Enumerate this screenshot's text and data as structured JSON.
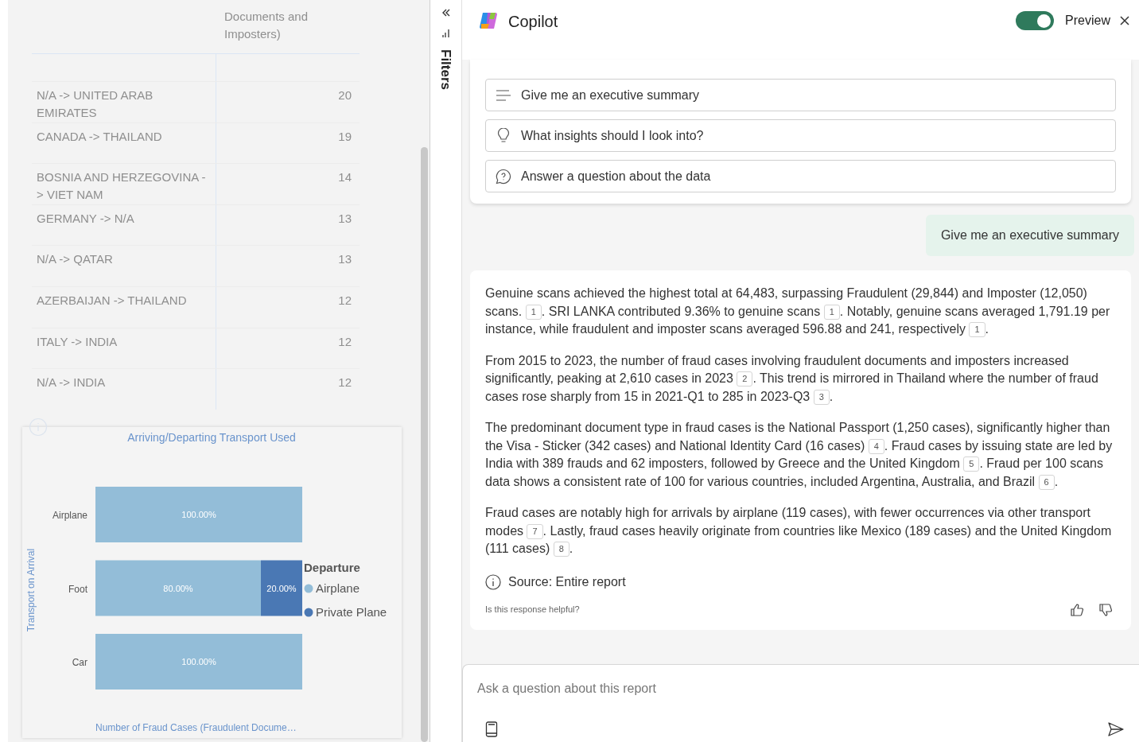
{
  "report": {
    "table": {
      "header": "Documents and Imposters)",
      "rows": [
        {
          "route": "N/A -> UNITED ARAB EMIRATES",
          "count": "20"
        },
        {
          "route": "CANADA -> THAILAND",
          "count": "19"
        },
        {
          "route": "BOSNIA AND HERZEGOVINA -> VIET NAM",
          "count": "14"
        },
        {
          "route": "GERMANY -> N/A",
          "count": "13"
        },
        {
          "route": "N/A -> QATAR",
          "count": "13"
        },
        {
          "route": "AZERBAIJAN -> THAILAND",
          "count": "12"
        },
        {
          "route": "ITALY -> INDIA",
          "count": "12"
        },
        {
          "route": "N/A -> INDIA",
          "count": "12"
        }
      ]
    },
    "chart": {
      "chart_data": {
        "type": "bar",
        "orientation": "horizontal",
        "stacked": true,
        "legend": {
          "title": "Departure"
        },
        "title": "Arriving/Departing Transport Used",
        "xlabel": "Number of Fraud Cases (Fraudulent Docume…",
        "ylabel": "Transport on Arrival",
        "categories": [
          "Airplane",
          "Foot",
          "Car"
        ],
        "series": [
          {
            "name": "Airplane",
            "color": "#93bdd8",
            "values": [
              100,
              80,
              100
            ],
            "value_labels": [
              "100.00%",
              "80.00%",
              "100.00%"
            ]
          },
          {
            "name": "Private Plane",
            "color": "#4a78b4",
            "values": [
              null,
              20,
              null
            ],
            "value_labels": [
              null,
              "20.00%",
              null
            ]
          }
        ]
      }
    }
  },
  "filters_pane": {
    "label": "Filters"
  },
  "copilot": {
    "title": "Copilot",
    "preview_toggle": {
      "on": true,
      "label": "Preview"
    },
    "suggestions": [
      {
        "kind": "summary",
        "label": "Give me an executive summary"
      },
      {
        "kind": "insights",
        "label": "What insights should I look into?"
      },
      {
        "kind": "question",
        "label": "Answer a question about the data"
      }
    ],
    "user_message": "Give me an executive summary",
    "response": {
      "paragraphs": [
        [
          {
            "text": "Genuine scans achieved the highest total at 64,483, surpassing Fraudulent (29,844) and Imposter (12,050) scans. "
          },
          {
            "cite": "1"
          },
          {
            "text": ". SRI LANKA contributed 9.36% to genuine scans "
          },
          {
            "cite": "1"
          },
          {
            "text": ". Notably, genuine scans averaged 1,791.19 per instance, while fraudulent and imposter scans averaged 596.88 and 241, respectively "
          },
          {
            "cite": "1"
          },
          {
            "text": "."
          }
        ],
        [
          {
            "text": "From 2015 to 2023, the number of fraud cases involving fraudulent documents and imposters increased significantly, peaking at 2,610 cases in 2023 "
          },
          {
            "cite": "2"
          },
          {
            "text": ". This trend is mirrored in Thailand where the number of fraud cases rose sharply from 15 in 2021-Q1 to 285 in 2023-Q3 "
          },
          {
            "cite": "3"
          },
          {
            "text": "."
          }
        ],
        [
          {
            "text": "The predominant document type in fraud cases is the National Passport (1,250 cases), significantly higher than the Visa - Sticker (342 cases) and National Identity Card (16 cases) "
          },
          {
            "cite": "4"
          },
          {
            "text": ". Fraud cases by issuing state are led by India with 389 frauds and 62 imposters, followed by Greece and the United Kingdom "
          },
          {
            "cite": "5"
          },
          {
            "text": ". Fraud per 100 scans data shows a consistent rate of 100 for various countries, included Argentina, Australia, and Brazil "
          },
          {
            "cite": "6"
          },
          {
            "text": "."
          }
        ],
        [
          {
            "text": "Fraud cases are notably high for arrivals by airplane (119 cases), with fewer occurrences via other transport modes "
          },
          {
            "cite": "7"
          },
          {
            "text": ". Lastly, fraud cases heavily originate from countries like Mexico (189 cases) and the United Kingdom (111 cases) "
          },
          {
            "cite": "8"
          },
          {
            "text": "."
          }
        ]
      ],
      "source": "Source: Entire report",
      "feedback_prompt": "Is this response helpful?"
    },
    "input": {
      "placeholder": "Ask a question about this report"
    }
  }
}
